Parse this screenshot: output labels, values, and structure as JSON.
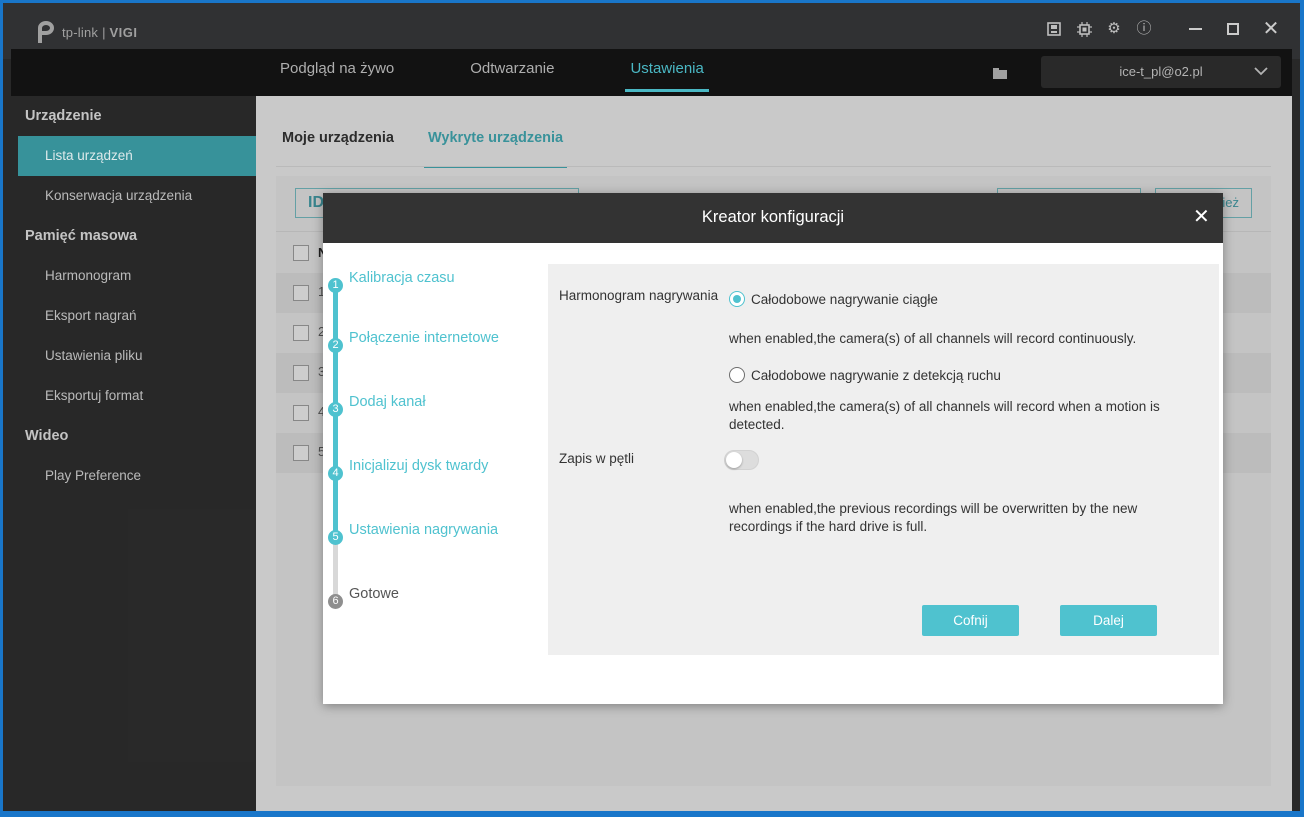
{
  "app": {
    "logo_brand": "tp-link",
    "logo_sep": "|",
    "logo_product": "VIGI"
  },
  "window_controls": {
    "minimize_icon": "minimize-icon",
    "maximize_icon": "maximize-icon",
    "close_glyph": "✕"
  },
  "system_icons": [
    {
      "name": "storage-icon"
    },
    {
      "name": "chip-icon"
    },
    {
      "name": "gear-icon",
      "glyph": "⚙"
    },
    {
      "name": "info-icon",
      "glyph": "ⓘ"
    }
  ],
  "nav": {
    "tabs": [
      {
        "label": "Podgląd na żywo",
        "active": false
      },
      {
        "label": "Odtwarzanie",
        "active": false
      },
      {
        "label": "Ustawienia",
        "active": true
      }
    ],
    "account": "ice-t_pl@o2.pl"
  },
  "sidebar": {
    "groups": [
      {
        "label": "Urządzenie",
        "items": [
          "Lista urządzeń",
          "Konserwacja urządzenia"
        ]
      },
      {
        "label": "Pamięć masowa",
        "items": [
          "Harmonogram",
          "Eksport nagrań",
          "Ustawienia pliku",
          "Eksportuj format"
        ]
      },
      {
        "label": "Wideo",
        "items": [
          "Play Preference"
        ]
      }
    ],
    "active_item": "Lista urządzeń"
  },
  "content": {
    "subtabs": [
      {
        "label": "Moje urządzenia",
        "active": false
      },
      {
        "label": "Wykryte urządzenia",
        "active": true
      }
    ],
    "id_box_text": "ID",
    "header_col": "N",
    "btn_right_label": "ież",
    "row_indices": [
      "1",
      "2",
      "3",
      "4",
      "5"
    ]
  },
  "dialog": {
    "title": "Kreator konfiguracji",
    "close_glyph": "✕",
    "steps": [
      {
        "num": "1",
        "label": "Kalibracja czasu",
        "done": true
      },
      {
        "num": "2",
        "label": "Połączenie internetowe",
        "done": true
      },
      {
        "num": "3",
        "label": "Dodaj kanał",
        "done": true
      },
      {
        "num": "4",
        "label": "Inicjalizuj dysk twardy",
        "done": true
      },
      {
        "num": "5",
        "label": "Ustawienia nagrywania",
        "done": true
      },
      {
        "num": "6",
        "label": "Gotowe",
        "done": false
      }
    ],
    "form": {
      "schedule_label": "Harmonogram nagrywania",
      "option_continuous": "Całodobowe nagrywanie ciągłe",
      "option_continuous_desc": "when enabled,the camera(s) of all channels will record continuously.",
      "option_motion": "Całodobowe nagrywanie z detekcją ruchu",
      "option_motion_desc": "when enabled,the camera(s) of all channels will record when a motion is detected.",
      "selected_option": "continuous",
      "loop_label": "Zapis w pętli",
      "loop_enabled": false,
      "loop_desc": "when enabled,the previous recordings will be overwritten by the new recordings if the hard drive is full.",
      "back_label": "Cofnij",
      "next_label": "Dalej"
    }
  },
  "colors": {
    "accent": "#4fc2cf",
    "sidebar_active": "#3a9aa3",
    "titlebar": "#333436",
    "desktop_frame": "#1976c9"
  }
}
